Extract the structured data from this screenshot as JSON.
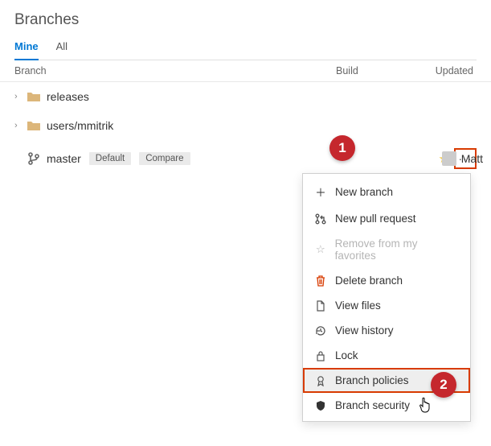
{
  "page_title": "Branches",
  "tabs": {
    "mine": "Mine",
    "all": "All"
  },
  "columns": {
    "branch": "Branch",
    "build": "Build",
    "updated": "Updated"
  },
  "rows": {
    "releases": {
      "label": "releases"
    },
    "users": {
      "label": "users/mmitrik"
    },
    "master": {
      "label": "master",
      "default_badge": "Default",
      "compare_badge": "Compare",
      "author": "Matt"
    }
  },
  "menu": {
    "new_branch": "New branch",
    "new_pr": "New pull request",
    "remove_fav": "Remove from my favorites",
    "delete": "Delete branch",
    "view_files": "View files",
    "view_history": "View history",
    "lock": "Lock",
    "policies": "Branch policies",
    "security": "Branch security"
  },
  "callouts": {
    "one": "1",
    "two": "2"
  }
}
